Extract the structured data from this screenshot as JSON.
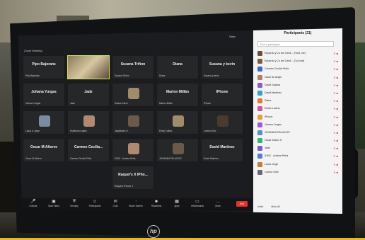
{
  "room": {
    "wall_sign": ""
  },
  "zoom": {
    "window_title": "Zoom Meeting",
    "view_label": "View",
    "tiles": [
      {
        "name": "Pipo Bajorans",
        "sub": "Pipo Bajorans",
        "kind": "name"
      },
      {
        "name": "",
        "sub": "",
        "kind": "photo-active"
      },
      {
        "name": "Susana Triñon",
        "sub": "Susana Triñon",
        "kind": "name"
      },
      {
        "name": "Diana",
        "sub": "Diana",
        "kind": "name"
      },
      {
        "name": "Susana y kevin",
        "sub": "Susana y kevin",
        "kind": "name"
      },
      {
        "name": "Johana Yurgas",
        "sub": "Johana Yurgas",
        "kind": "name"
      },
      {
        "name": "Jade",
        "sub": "Jade",
        "kind": "name"
      },
      {
        "name": "",
        "sub": "Sacha Cabre",
        "kind": "avatar"
      },
      {
        "name": "Marlon Millán",
        "sub": "Marlon Millán",
        "kind": "name"
      },
      {
        "name": "IPhone",
        "sub": "IPhone",
        "kind": "name"
      },
      {
        "name": "",
        "sub": "Laura & Jorge",
        "kind": "avatar"
      },
      {
        "name": "",
        "sub": "Estefanía Ladino",
        "kind": "avatar"
      },
      {
        "name": "",
        "sub": "JasyMateo O.",
        "kind": "avatar"
      },
      {
        "name": "",
        "sub": "Emily Calisto",
        "kind": "avatar"
      },
      {
        "name": "",
        "sub": "Lorena Ortiz",
        "kind": "avatar"
      },
      {
        "name": "Oscar M Añorve",
        "sub": "Oscar M Añorve",
        "kind": "name"
      },
      {
        "name": "Carmen Cecilia...",
        "sub": "Carmen Cecilia Peña",
        "kind": "name"
      },
      {
        "name": "",
        "sub": "ICMC - Andrea Peña",
        "kind": "avatar"
      },
      {
        "name": "",
        "sub": "JOHANNA PALACIOS",
        "kind": "avatar"
      },
      {
        "name": "David Martinez",
        "sub": "David Martinez",
        "kind": "name"
      },
      {
        "name": "Raquel's X IPho...",
        "sub": "Raquel's iPhone X",
        "kind": "name"
      }
    ],
    "toolbar": {
      "items": [
        "Unmute",
        "Start Video",
        "Security",
        "Participants",
        "Chat",
        "Share Screen",
        "Reactions",
        "Apps",
        "Whiteboards",
        "More"
      ],
      "end_label": "End"
    },
    "participants": {
      "title": "Participants (21)",
      "search_placeholder": "Find a participant",
      "rows": [
        {
          "name": "Eduardo y Co del Cardi... (Host, me)",
          "color": "#6a4d3a"
        },
        {
          "name": "Eduardo y Co del Cardi... (Co-host)",
          "color": "#7a5a40"
        },
        {
          "name": "Carmen Cecilia Peña",
          "color": "#3c6ac8"
        },
        {
          "name": "Clase de Angie",
          "color": "#b08060"
        },
        {
          "name": "David Salazar",
          "color": "#8a5ad0"
        },
        {
          "name": "David Martinez",
          "color": "#3aa0c8"
        },
        {
          "name": "Diana",
          "color": "#e0783a"
        },
        {
          "name": "Emilio Ladino",
          "color": "#c85aa0"
        },
        {
          "name": "IPhone",
          "color": "#e0a03a"
        },
        {
          "name": "Johana Yurgas",
          "color": "#a05ad0"
        },
        {
          "name": "JOHANNA PALACIOS",
          "color": "#5a8ad0"
        },
        {
          "name": "Oscar Mateo S.",
          "color": "#3ab07a"
        },
        {
          "name": "Jade",
          "color": "#7a5ad0"
        },
        {
          "name": "ICMC - Andrea Peña",
          "color": "#5a7ad0"
        },
        {
          "name": "Laura Jorge",
          "color": "#c87a3a"
        },
        {
          "name": "Lorena Ortiz",
          "color": "#6a6a6a"
        }
      ],
      "footer_invite": "Invite",
      "footer_mute": "Mute All"
    }
  }
}
